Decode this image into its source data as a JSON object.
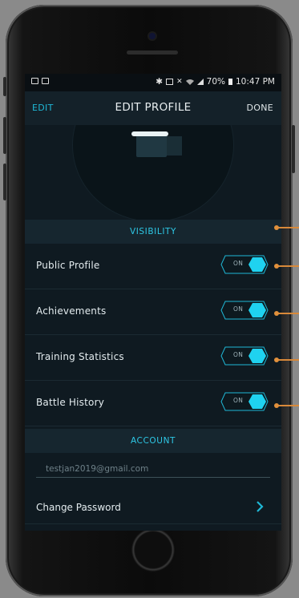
{
  "status_bar": {
    "battery": "70%",
    "time": "10:47 PM"
  },
  "navbar": {
    "edit_label": "EDIT",
    "title": "EDIT PROFILE",
    "done_label": "DONE"
  },
  "visibility": {
    "heading": "VISIBILITY",
    "rows": [
      {
        "label": "Public Profile",
        "toggle": "ON"
      },
      {
        "label": "Achievements",
        "toggle": "ON"
      },
      {
        "label": "Training Statistics",
        "toggle": "ON"
      },
      {
        "label": "Battle History",
        "toggle": "ON"
      }
    ]
  },
  "account": {
    "heading": "ACCOUNT",
    "email_placeholder": "testjan2019@gmail.com",
    "change_password_label": "Change Password"
  },
  "colors": {
    "accent_cyan": "#1fb8d6",
    "toggle_knob": "#1fd2f0",
    "callout": "#e0903c"
  },
  "icons": [
    "image-icon",
    "notification-icon",
    "bluetooth-icon",
    "nfc-icon",
    "mute-icon",
    "wifi-icon",
    "signal-icon",
    "battery-icon",
    "chevron-right-icon"
  ]
}
